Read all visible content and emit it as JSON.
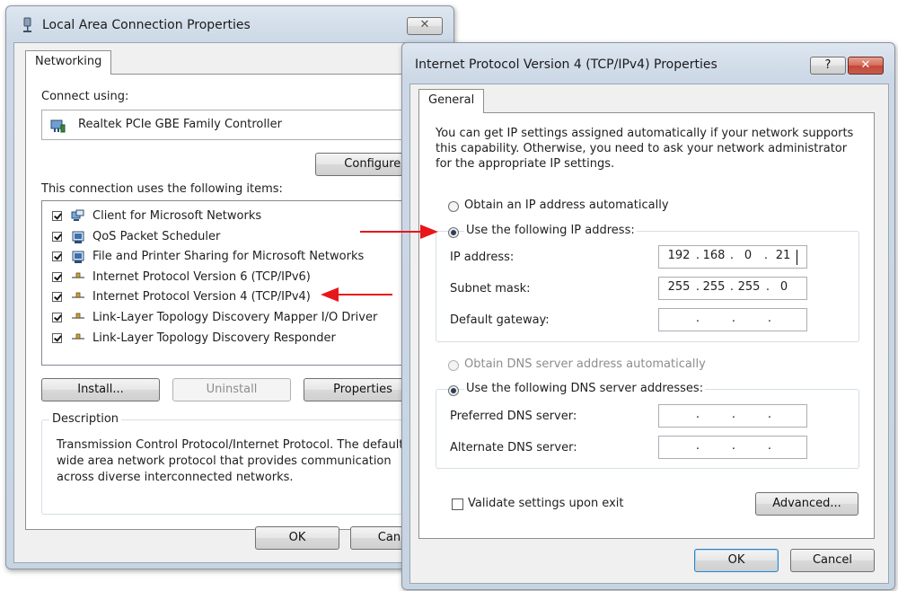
{
  "lac_window": {
    "title": "Local Area Connection Properties",
    "tab": "Networking",
    "connect_using_label": "Connect using:",
    "adapter": "Realtek PCIe GBE Family Controller",
    "configure_button": "Configure...",
    "items_label": "This connection uses the following items:",
    "items": [
      {
        "label": "Client for Microsoft Networks",
        "icon": "network-client-icon",
        "checked": true
      },
      {
        "label": "QoS Packet Scheduler",
        "icon": "service-icon",
        "checked": true
      },
      {
        "label": "File and Printer Sharing for Microsoft Networks",
        "icon": "service-icon",
        "checked": true
      },
      {
        "label": "Internet Protocol Version 6 (TCP/IPv6)",
        "icon": "protocol-icon",
        "checked": true
      },
      {
        "label": "Internet Protocol Version 4 (TCP/IPv4)",
        "icon": "protocol-icon",
        "checked": true
      },
      {
        "label": "Link-Layer Topology Discovery Mapper I/O Driver",
        "icon": "protocol-icon",
        "checked": true
      },
      {
        "label": "Link-Layer Topology Discovery Responder",
        "icon": "protocol-icon",
        "checked": true
      }
    ],
    "install_button": "Install...",
    "uninstall_button": "Uninstall",
    "properties_button": "Properties",
    "description_label": "Description",
    "description_lines": [
      "Transmission Control Protocol/Internet Protocol. The default",
      "wide area network protocol that provides communication",
      "across diverse interconnected networks."
    ],
    "ok_button": "OK",
    "cancel_button_partial": "Canc"
  },
  "ipv4_window": {
    "title": "Internet Protocol Version 4 (TCP/IPv4) Properties",
    "help_button": "?",
    "tab": "General",
    "intro_lines": [
      "You can get IP settings assigned automatically if your network supports",
      "this capability. Otherwise, you need to ask your network administrator",
      "for the appropriate IP settings."
    ],
    "obtain_ip_auto": "Obtain an IP address automatically",
    "use_following_ip": "Use the following IP address:",
    "ip_address_label": "IP address:",
    "ip_address": [
      "192",
      "168",
      "0",
      "21"
    ],
    "subnet_mask_label": "Subnet mask:",
    "subnet_mask": [
      "255",
      "255",
      "255",
      "0"
    ],
    "default_gateway_label": "Default gateway:",
    "obtain_dns_auto": "Obtain DNS server address automatically",
    "use_following_dns": "Use the following DNS server addresses:",
    "preferred_dns_label": "Preferred DNS server:",
    "alternate_dns_label": "Alternate DNS server:",
    "validate_label": "Validate settings upon exit",
    "validate_checked": false,
    "advanced_button": "Advanced...",
    "ok_button": "OK",
    "cancel_button": "Cancel"
  },
  "colors": {
    "arrow": "#e8161b",
    "close_button": "#c8453b"
  }
}
